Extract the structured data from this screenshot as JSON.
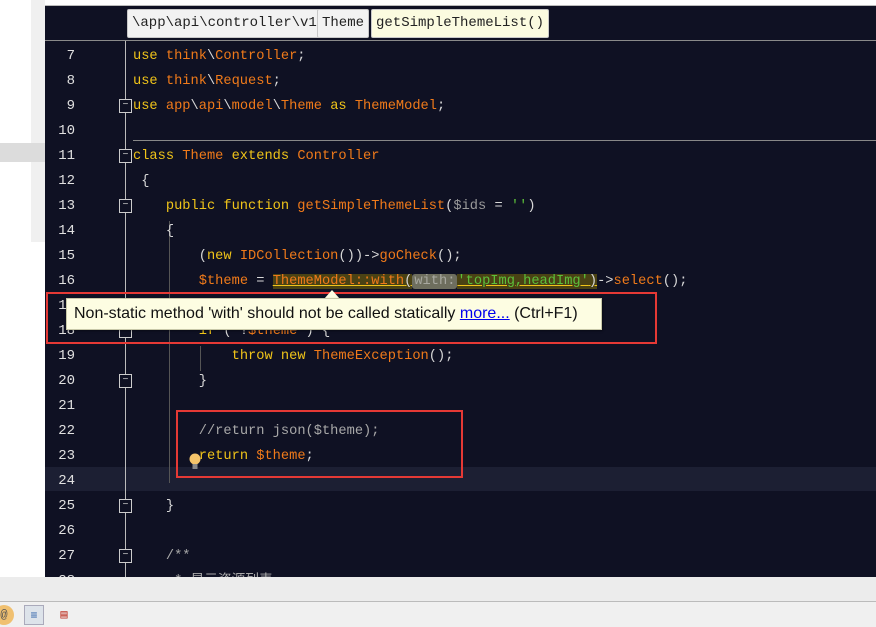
{
  "breadcrumb": [
    "\\app\\api\\controller\\v1",
    "Theme",
    "getSimpleThemeList()"
  ],
  "lines": [
    {
      "n": "7",
      "i": 0,
      "t": [
        [
          "kw",
          "use "
        ],
        [
          "id",
          "think"
        ],
        [
          "pl",
          "\\"
        ],
        [
          "id",
          "Controller"
        ],
        [
          "pl",
          ";"
        ]
      ]
    },
    {
      "n": "8",
      "i": 0,
      "t": [
        [
          "kw",
          "use "
        ],
        [
          "id",
          "think"
        ],
        [
          "pl",
          "\\"
        ],
        [
          "id",
          "Request"
        ],
        [
          "pl",
          ";"
        ]
      ]
    },
    {
      "n": "9",
      "i": 0,
      "t": [
        [
          "kw",
          "use "
        ],
        [
          "id",
          "app"
        ],
        [
          "pl",
          "\\"
        ],
        [
          "id",
          "api"
        ],
        [
          "pl",
          "\\"
        ],
        [
          "id",
          "model"
        ],
        [
          "pl",
          "\\"
        ],
        [
          "id",
          "Theme"
        ],
        [
          "kw",
          " as "
        ],
        [
          "id",
          "ThemeModel"
        ],
        [
          "pl",
          ";"
        ]
      ]
    },
    {
      "n": "10",
      "i": 0,
      "t": []
    },
    {
      "n": "11",
      "i": 0,
      "t": [
        [
          "kw",
          "class "
        ],
        [
          "id",
          "Theme"
        ],
        [
          "kw",
          " extends "
        ],
        [
          "id",
          "Controller"
        ]
      ]
    },
    {
      "n": "12",
      "i": 0,
      "t": [
        [
          "pl",
          " {"
        ]
      ]
    },
    {
      "n": "13",
      "i": 4,
      "t": [
        [
          "kw",
          "public function "
        ],
        [
          "id",
          "getSimpleThemeList"
        ],
        [
          "pl",
          "("
        ],
        [
          "dim",
          "$ids"
        ],
        [
          "pl",
          " = "
        ],
        [
          "st",
          "''"
        ],
        [
          "pl",
          ")"
        ]
      ]
    },
    {
      "n": "14",
      "i": 4,
      "t": [
        [
          "pl",
          "{"
        ]
      ]
    },
    {
      "n": "15",
      "i": 8,
      "t": [
        [
          "pl",
          "("
        ],
        [
          "kw",
          "new "
        ],
        [
          "id",
          "IDCollection"
        ],
        [
          "pl",
          "())->"
        ],
        [
          "id",
          "goCheck"
        ],
        [
          "pl",
          "();"
        ]
      ]
    },
    {
      "n": "16",
      "i": 8,
      "t": [
        [
          "vr",
          "$theme"
        ],
        [
          "pl",
          " = "
        ],
        [
          "hlid",
          "ThemeModel::with"
        ],
        [
          "hlpl",
          "("
        ],
        [
          "hint",
          "with:"
        ],
        [
          "hlst",
          "'topImg,headImg'"
        ],
        [
          "hlpl",
          ")"
        ],
        [
          "pl",
          "->"
        ],
        [
          "id",
          "select"
        ],
        [
          "pl",
          "();"
        ]
      ]
    },
    {
      "n": "17",
      "i": 8,
      "t": []
    },
    {
      "n": "18",
      "i": 8,
      "t": [
        [
          "kw",
          "if"
        ],
        [
          "pl",
          " ( !"
        ],
        [
          "vr",
          "$theme"
        ],
        [
          "pl",
          " ) {"
        ]
      ]
    },
    {
      "n": "19",
      "i": 12,
      "t": [
        [
          "kw",
          "throw new "
        ],
        [
          "id",
          "ThemeException"
        ],
        [
          "pl",
          "();"
        ]
      ]
    },
    {
      "n": "20",
      "i": 8,
      "t": [
        [
          "pl",
          "}"
        ]
      ]
    },
    {
      "n": "21",
      "i": 0,
      "t": []
    },
    {
      "n": "22",
      "i": 8,
      "t": [
        [
          "cm",
          "//return json($theme);"
        ]
      ]
    },
    {
      "n": "23",
      "i": 8,
      "t": [
        [
          "kw",
          "return "
        ],
        [
          "vr",
          "$theme"
        ],
        [
          "pl",
          ";"
        ]
      ]
    },
    {
      "n": "24",
      "i": 0,
      "t": []
    },
    {
      "n": "25",
      "i": 4,
      "t": [
        [
          "pl",
          "}"
        ]
      ]
    },
    {
      "n": "26",
      "i": 0,
      "t": []
    },
    {
      "n": "27",
      "i": 4,
      "t": [
        [
          "cm",
          "/**"
        ]
      ]
    },
    {
      "n": "28",
      "i": 5,
      "t": [
        [
          "cm",
          "* 显示资源列表"
        ]
      ]
    }
  ],
  "tooltip": {
    "message": "Non-static method 'with' should not be called statically ",
    "link": "more...",
    "shortcut": " (Ctrl+F1)"
  },
  "colors": {
    "keyword": "#f0c419",
    "identifier": "#f07a1a",
    "string": "#5cc03a",
    "comment": "#a8a8a8",
    "background": "#0f1123",
    "annotation": "#e53935"
  },
  "icons": [
    "lightbulb-icon",
    "at-sign-icon",
    "line-numbers-icon",
    "clipboard-icon"
  ]
}
